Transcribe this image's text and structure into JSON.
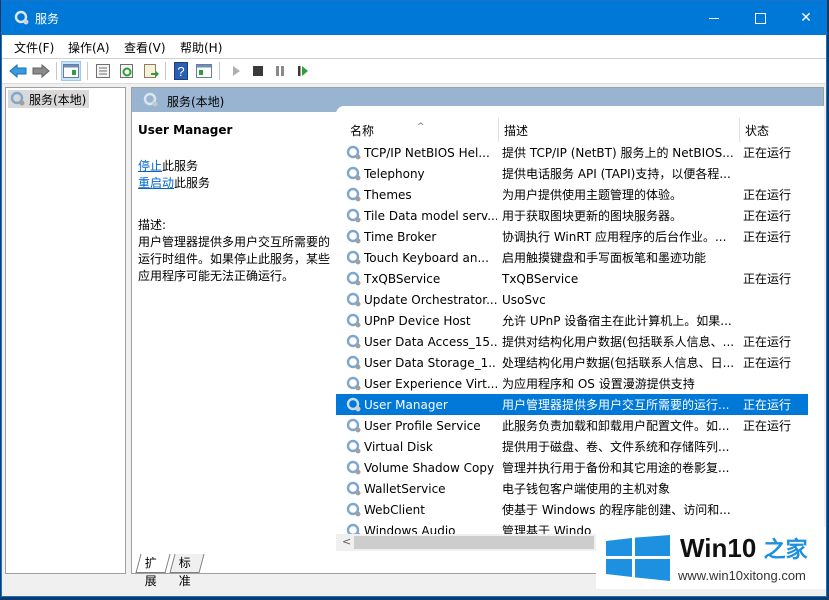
{
  "window": {
    "title": "服务",
    "controls": {
      "minimize": "minimize",
      "maximize": "maximize",
      "close": "✕"
    }
  },
  "menu": [
    {
      "label": "文件(F)"
    },
    {
      "label": "操作(A)"
    },
    {
      "label": "查看(V)"
    },
    {
      "label": "帮助(H)"
    }
  ],
  "toolbar": {
    "buttons": [
      {
        "icon": "back-arrow-icon"
      },
      {
        "icon": "forward-arrow-icon"
      },
      {
        "icon": "show-console-tree-icon",
        "active": true
      },
      {
        "icon": "properties-icon"
      },
      {
        "icon": "refresh-icon"
      },
      {
        "icon": "export-list-icon"
      },
      {
        "icon": "help-icon"
      },
      {
        "icon": "action-pane-icon"
      },
      {
        "icon": "start-service-icon"
      },
      {
        "icon": "stop-service-icon"
      },
      {
        "icon": "pause-service-icon"
      },
      {
        "icon": "resume-service-icon"
      }
    ]
  },
  "tree": {
    "root_label": "服务(本地)"
  },
  "right_pane": {
    "header": "服务(本地)",
    "detail": {
      "service_name": "User Manager",
      "stop_link": "停止",
      "stop_suffix": "此服务",
      "restart_link": "重启动",
      "restart_suffix": "此服务",
      "desc_label": "描述:",
      "desc_text": "用户管理器提供多用户交互所需要的运行时组件。如果停止此服务，某些应用程序可能无法正确运行。"
    },
    "columns": {
      "name": "名称",
      "description": "描述",
      "status": "状态"
    },
    "services": [
      {
        "name": "TCP/IP NetBIOS Hel...",
        "description": "提供 TCP/IP (NetBT) 服务上的 NetBIOS...",
        "status": "正在运行"
      },
      {
        "name": "Telephony",
        "description": "提供电话服务 API (TAPI)支持，以便各程...",
        "status": ""
      },
      {
        "name": "Themes",
        "description": "为用户提供使用主题管理的体验。",
        "status": "正在运行"
      },
      {
        "name": "Tile Data model serv...",
        "description": "用于获取图块更新的图块服务器。",
        "status": "正在运行"
      },
      {
        "name": "Time Broker",
        "description": "协调执行 WinRT 应用程序的后台作业。...",
        "status": "正在运行"
      },
      {
        "name": "Touch Keyboard an...",
        "description": "启用触摸键盘和手写面板笔和墨迹功能",
        "status": ""
      },
      {
        "name": "TxQBService",
        "description": "TxQBService",
        "status": "正在运行"
      },
      {
        "name": "Update Orchestrator...",
        "description": "UsoSvc",
        "status": ""
      },
      {
        "name": "UPnP Device Host",
        "description": "允许 UPnP 设备宿主在此计算机上。如果...",
        "status": ""
      },
      {
        "name": "User Data Access_15...",
        "description": "提供对结构化用户数据(包括联系人信息、...",
        "status": "正在运行"
      },
      {
        "name": "User Data Storage_1...",
        "description": "处理结构化用户数据(包括联系人信息、日...",
        "status": "正在运行"
      },
      {
        "name": "User Experience Virt...",
        "description": "为应用程序和 OS 设置漫游提供支持",
        "status": ""
      },
      {
        "name": "User Manager",
        "description": "用户管理器提供多用户交互所需要的运行...",
        "status": "正在运行",
        "selected": true
      },
      {
        "name": "User Profile Service",
        "description": "此服务负责加载和卸载用户配置文件。如...",
        "status": "正在运行"
      },
      {
        "name": "Virtual Disk",
        "description": "提供用于磁盘、卷、文件系统和存储阵列...",
        "status": ""
      },
      {
        "name": "Volume Shadow Copy",
        "description": "管理并执行用于备份和其它用途的卷影复...",
        "status": ""
      },
      {
        "name": "WalletService",
        "description": "电子钱包客户端使用的主机对象",
        "status": ""
      },
      {
        "name": "WebClient",
        "description": "使基于 Windows 的程序能创建、访问和...",
        "status": ""
      },
      {
        "name": "Windows Audio",
        "description": "管理基于 Windo",
        "status": ""
      }
    ],
    "tabs": [
      {
        "label": "扩展"
      },
      {
        "label": "标准"
      }
    ]
  },
  "watermark": {
    "title": "Win10",
    "title_cn": "之家",
    "url": "www.win10xitong.com",
    "colors": {
      "logo": "#1e90e0"
    }
  }
}
